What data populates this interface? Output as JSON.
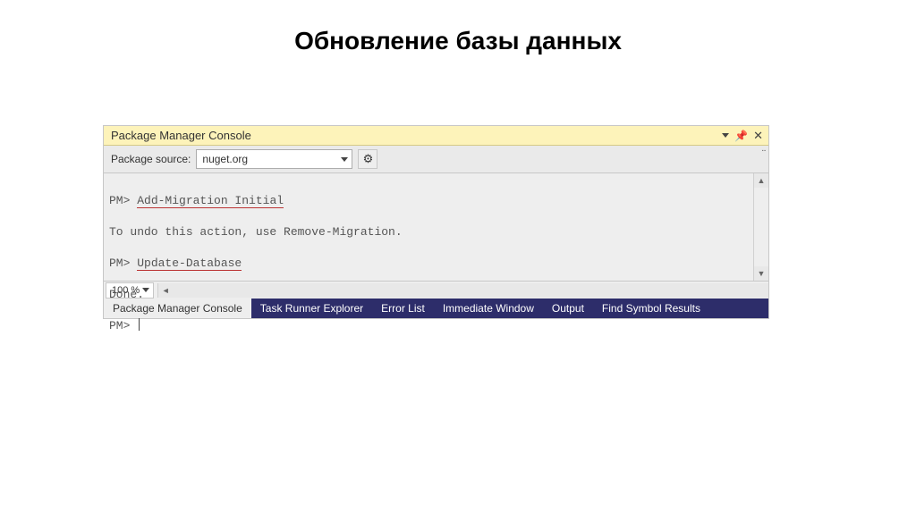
{
  "heading": "Обновление базы данных",
  "panel": {
    "title": "Package Manager Console",
    "toolbar": {
      "label": "Package source:",
      "selected": "nuget.org"
    },
    "console": {
      "l1_prompt": "PM>",
      "l1_cmd": "Add-Migration Initial",
      "l2": "To undo this action, use Remove-Migration.",
      "l3_prompt": "PM>",
      "l3_cmd": "Update-Database",
      "l4": "Done.",
      "l5_prompt": "PM>"
    },
    "zoom": "100 %",
    "tabs": [
      "Package Manager Console",
      "Task Runner Explorer",
      "Error List",
      "Immediate Window",
      "Output",
      "Find Symbol Results"
    ]
  }
}
